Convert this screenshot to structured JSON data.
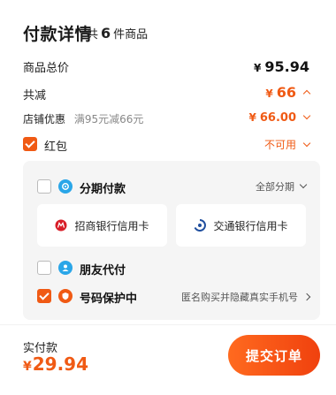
{
  "header": {
    "title": "付款详情",
    "count_prefix": "共",
    "count_num": "6",
    "count_suffix": "件商品"
  },
  "summary": {
    "total_label": "商品总价",
    "total_currency": "¥",
    "total_value": "95.94",
    "discount_label": "共减",
    "discount_currency": "¥",
    "discount_value": "66",
    "store_label": "店铺优惠",
    "store_desc": "满95元减66元",
    "store_currency": "¥",
    "store_value": "66.00",
    "redpacket_label": "红包",
    "redpacket_status": "不可用"
  },
  "payment_panel": {
    "installment": {
      "label": "分期付款",
      "option": "全部分期",
      "checked": false
    },
    "banks": [
      {
        "name": "招商银行信用卡",
        "icon": "cmb-bank-icon"
      },
      {
        "name": "交通银行信用卡",
        "icon": "bocom-bank-icon"
      }
    ],
    "friend_pay": {
      "label": "朋友代付",
      "checked": false
    },
    "number_protect": {
      "label": "号码保护中",
      "desc": "匿名购买并隐藏真实手机号",
      "checked": true
    }
  },
  "footer": {
    "paid_label": "实付款",
    "paid_currency": "¥",
    "paid_value": "29.94",
    "submit_label": "提交订单"
  },
  "colors": {
    "accent": "#f05a14",
    "installment_icon": "#2aa6e8",
    "friend_icon": "#2aa6e8",
    "protect_icon": "#f05a14"
  }
}
